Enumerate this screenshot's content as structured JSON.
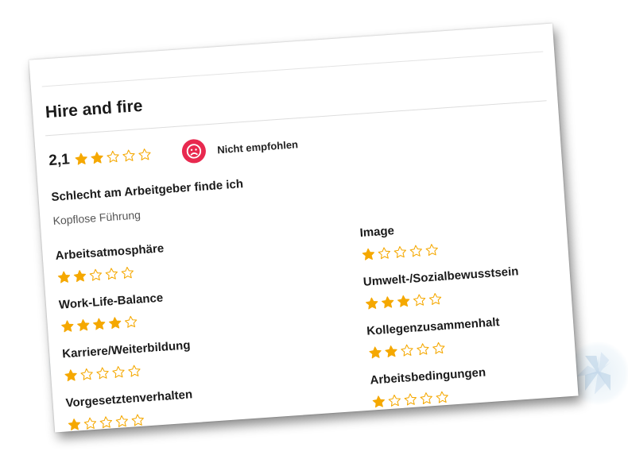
{
  "review": {
    "title": "Hire and fire",
    "score": "2,1",
    "score_value": 2.1,
    "score_stars": 2,
    "recommendation": {
      "label": "Nicht empfohlen",
      "icon": "sad-face-icon",
      "color": "#e8294f"
    },
    "headline": "Schlecht am Arbeitgeber finde ich",
    "text": "Kopflose Führung"
  },
  "categories_left": [
    {
      "label": "Arbeitsatmosphäre",
      "stars": 2
    },
    {
      "label": "Work-Life-Balance",
      "stars": 4
    },
    {
      "label": "Karriere/Weiterbildung",
      "stars": 1
    },
    {
      "label": "Vorgesetztenverhalten",
      "stars": 1
    }
  ],
  "categories_right": [
    {
      "label": "Image",
      "stars": 1
    },
    {
      "label": "Umwelt-/Sozialbewusstsein",
      "stars": 3
    },
    {
      "label": "Kollegenzusammenhalt",
      "stars": 2
    },
    {
      "label": "Arbeitsbedingungen",
      "stars": 1
    }
  ],
  "colors": {
    "star_filled": "#f5a800",
    "star_empty_outline": "#f5a800"
  }
}
